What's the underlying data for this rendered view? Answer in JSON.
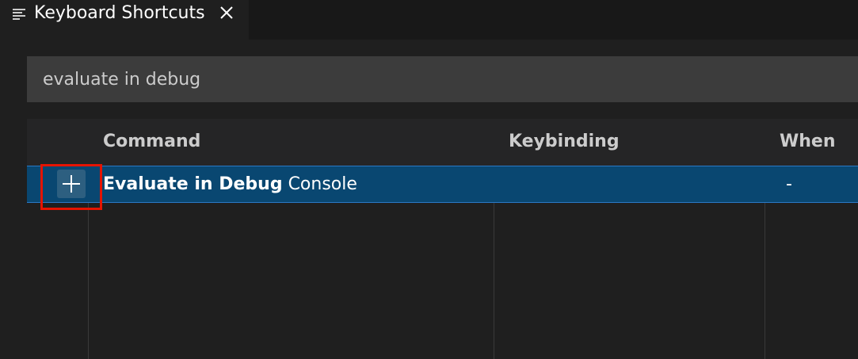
{
  "tab": {
    "title": "Keyboard Shortcuts",
    "icon": "lines-icon",
    "close_icon": "close-icon"
  },
  "search": {
    "value": "evaluate in debug"
  },
  "table": {
    "columns": [
      "Command",
      "Keybinding",
      "When"
    ],
    "rows": [
      {
        "command_match": "Evaluate in Debug",
        "command_rest": " Console",
        "keybinding": "",
        "when": "-",
        "selected": true
      }
    ]
  },
  "colors": {
    "row_selected": "#094771",
    "highlight": "#e51400",
    "background": "#1f1f1f"
  }
}
